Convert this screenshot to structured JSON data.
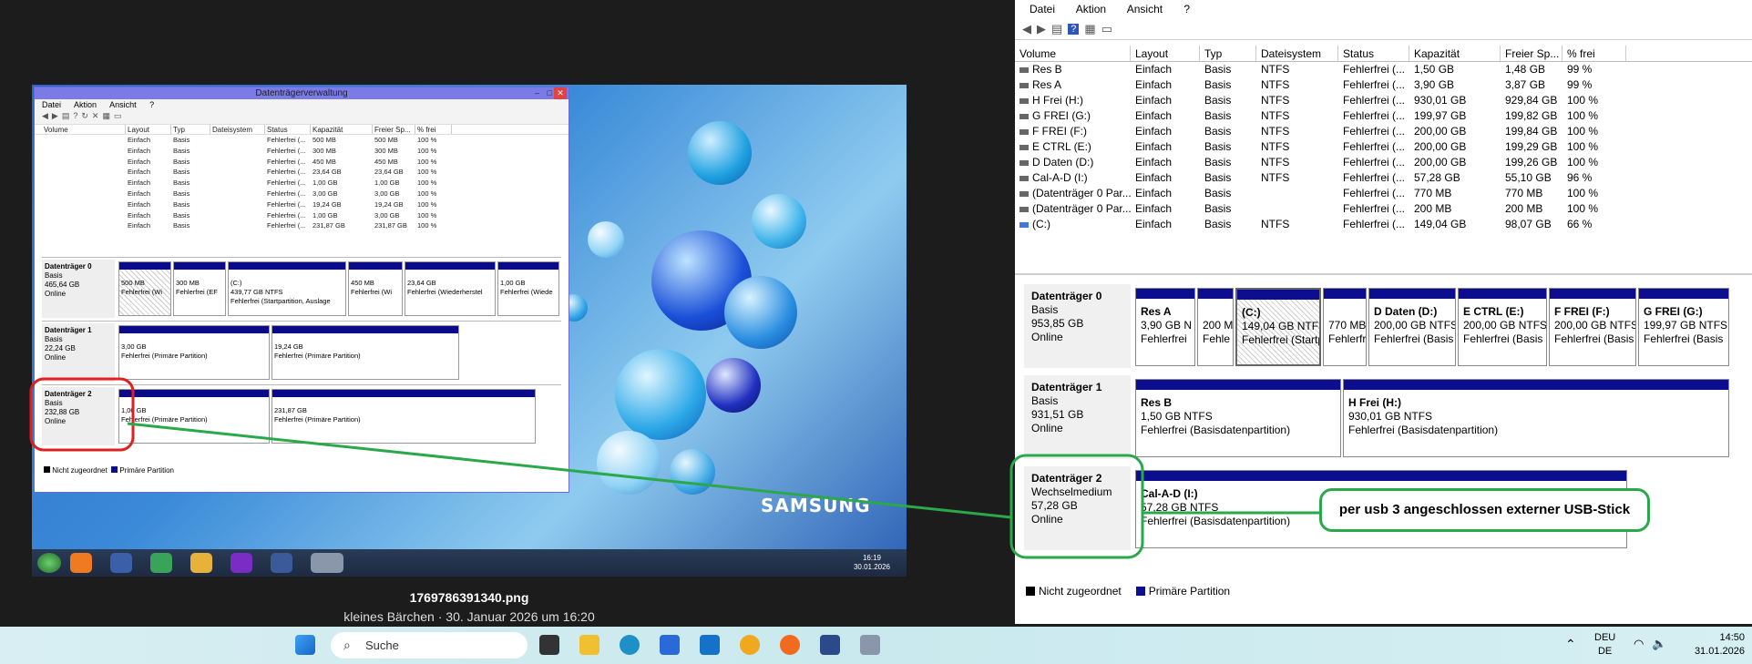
{
  "mini_window": {
    "title": "Datenträgerverwaltung",
    "menu": [
      "Datei",
      "Aktion",
      "Ansicht",
      "?"
    ],
    "columns": [
      "Volume",
      "Layout",
      "Typ",
      "Dateisystem",
      "Status",
      "Kapazität",
      "Freier Sp...",
      "% frei"
    ],
    "rows": [
      [
        "",
        "Einfach",
        "Basis",
        "",
        "Fehlerfrei (...",
        "500 MB",
        "500 MB",
        "100 %"
      ],
      [
        "",
        "Einfach",
        "Basis",
        "",
        "Fehlerfrei (...",
        "300 MB",
        "300 MB",
        "100 %"
      ],
      [
        "",
        "Einfach",
        "Basis",
        "",
        "Fehlerfrei (...",
        "450 MB",
        "450 MB",
        "100 %"
      ],
      [
        "",
        "Einfach",
        "Basis",
        "",
        "Fehlerfrei (...",
        "23,64 GB",
        "23,64 GB",
        "100 %"
      ],
      [
        "",
        "Einfach",
        "Basis",
        "",
        "Fehlerfrei (...",
        "1,00 GB",
        "1,00 GB",
        "100 %"
      ],
      [
        "",
        "Einfach",
        "Basis",
        "",
        "Fehlerfrei (...",
        "3,00 GB",
        "3,00 GB",
        "100 %"
      ],
      [
        "",
        "Einfach",
        "Basis",
        "",
        "Fehlerfrei (...",
        "19,24 GB",
        "19,24 GB",
        "100 %"
      ],
      [
        "",
        "Einfach",
        "Basis",
        "",
        "Fehlerfrei (...",
        "1,00 GB",
        "3,00 GB",
        "100 %"
      ],
      [
        "",
        "Einfach",
        "Basis",
        "",
        "Fehlerfrei (...",
        "231,87 GB",
        "231,87 GB",
        "100 %"
      ]
    ],
    "disks": [
      {
        "name": "Datenträger 0",
        "type": "Basis",
        "size": "465,64 GB",
        "state": "Online",
        "parts": [
          [
            "500 MB",
            "Fehlerfrei (Wi"
          ],
          [
            "300 MB",
            "Fehlerfrei (EF"
          ],
          [
            "(C:)",
            "439,77 GB NTFS",
            "Fehlerfrei (Startpartition, Auslage"
          ],
          [
            "450 MB",
            "Fehlerfrei (Wi"
          ],
          [
            "23,64 GB",
            "Fehlerfrei (Wiederherstel"
          ],
          [
            "1,00 GB",
            "Fehlerfrei (Wiede"
          ]
        ]
      },
      {
        "name": "Datenträger 1",
        "type": "Basis",
        "size": "22,24 GB",
        "state": "Online",
        "parts": [
          [
            "3,00 GB",
            "Fehlerfrei (Primäre Partition)"
          ],
          [
            "19,24 GB",
            "Fehlerfrei (Primäre Partition)"
          ]
        ]
      },
      {
        "name": "Datenträger 2",
        "type": "Basis",
        "size": "232,88 GB",
        "state": "Online",
        "parts": [
          [
            "1,00 GB",
            "Fehlerfrei (Primäre Partition)"
          ],
          [
            "231,87 GB",
            "Fehlerfrei (Primäre Partition)"
          ]
        ]
      }
    ],
    "legend": [
      "Nicht zugeordnet",
      "Primäre Partition"
    ],
    "clock_time": "16:19",
    "clock_date": "30.01.2026",
    "brand": "SAMSUNG"
  },
  "caption": {
    "filename": "1769786391340.png",
    "meta": "kleines Bärchen · 30. Januar 2026 um 16:20"
  },
  "right_window": {
    "menu": [
      "Datei",
      "Aktion",
      "Ansicht",
      "?"
    ],
    "columns": [
      "Volume",
      "Layout",
      "Typ",
      "Dateisystem",
      "Status",
      "Kapazität",
      "Freier Sp...",
      "% frei"
    ],
    "rows": [
      [
        "Res B",
        "Einfach",
        "Basis",
        "NTFS",
        "Fehlerfrei (...",
        "1,50 GB",
        "1,48 GB",
        "99 %"
      ],
      [
        "Res A",
        "Einfach",
        "Basis",
        "NTFS",
        "Fehlerfrei (...",
        "3,90 GB",
        "3,87 GB",
        "99 %"
      ],
      [
        "H Frei (H:)",
        "Einfach",
        "Basis",
        "NTFS",
        "Fehlerfrei (...",
        "930,01 GB",
        "929,84 GB",
        "100 %"
      ],
      [
        "G FREI (G:)",
        "Einfach",
        "Basis",
        "NTFS",
        "Fehlerfrei (...",
        "199,97 GB",
        "199,82 GB",
        "100 %"
      ],
      [
        "F FREI (F:)",
        "Einfach",
        "Basis",
        "NTFS",
        "Fehlerfrei (...",
        "200,00 GB",
        "199,84 GB",
        "100 %"
      ],
      [
        "E CTRL (E:)",
        "Einfach",
        "Basis",
        "NTFS",
        "Fehlerfrei (...",
        "200,00 GB",
        "199,29 GB",
        "100 %"
      ],
      [
        "D Daten (D:)",
        "Einfach",
        "Basis",
        "NTFS",
        "Fehlerfrei (...",
        "200,00 GB",
        "199,26 GB",
        "100 %"
      ],
      [
        "Cal-A-D (I:)",
        "Einfach",
        "Basis",
        "NTFS",
        "Fehlerfrei (...",
        "57,28 GB",
        "55,10 GB",
        "96 %"
      ],
      [
        "(Datenträger 0 Par...",
        "Einfach",
        "Basis",
        "",
        "Fehlerfrei (...",
        "770 MB",
        "770 MB",
        "100 %"
      ],
      [
        "(Datenträger 0 Par...",
        "Einfach",
        "Basis",
        "",
        "Fehlerfrei (...",
        "200 MB",
        "200 MB",
        "100 %"
      ],
      [
        "(C:)",
        "Einfach",
        "Basis",
        "NTFS",
        "Fehlerfrei (...",
        "149,04 GB",
        "98,07 GB",
        "66 %"
      ]
    ],
    "disk0": {
      "name": "Datenträger 0",
      "type": "Basis",
      "size": "953,85 GB",
      "state": "Online",
      "parts": [
        {
          "name": "Res A",
          "size": "3,90 GB N",
          "status": "Fehlerfrei"
        },
        {
          "name": "",
          "size": "200 M",
          "status": "Fehle"
        },
        {
          "name": "(C:)",
          "size": "149,04 GB NTFS",
          "status": "Fehlerfrei (Startp"
        },
        {
          "name": "",
          "size": "770 MB",
          "status": "Fehlerfr"
        },
        {
          "name": "D Daten  (D:)",
          "size": "200,00 GB NTFS",
          "status": "Fehlerfrei (Basis"
        },
        {
          "name": "E CTRL  (E:)",
          "size": "200,00 GB NTFS",
          "status": "Fehlerfrei (Basis"
        },
        {
          "name": "F FREI  (F:)",
          "size": "200,00 GB NTFS",
          "status": "Fehlerfrei (Basis"
        },
        {
          "name": "G FREI  (G:)",
          "size": "199,97 GB NTFS",
          "status": "Fehlerfrei (Basis"
        }
      ]
    },
    "disk1": {
      "name": "Datenträger 1",
      "type": "Basis",
      "size": "931,51 GB",
      "state": "Online",
      "parts": [
        {
          "name": "Res B",
          "size": "1,50 GB NTFS",
          "status": "Fehlerfrei (Basisdatenpartition)"
        },
        {
          "name": "H Frei  (H:)",
          "size": "930,01 GB NTFS",
          "status": "Fehlerfrei (Basisdatenpartition)"
        }
      ]
    },
    "disk2": {
      "name": "Datenträger 2",
      "type": "Wechselmedium",
      "size": "57,28 GB",
      "state": "Online",
      "parts": [
        {
          "name": "Cal-A-D  (I:)",
          "size": "57,28 GB NTFS",
          "status": "Fehlerfrei (Basisdatenpartition)"
        }
      ]
    },
    "legend": [
      "Nicht zugeordnet",
      "Primäre Partition"
    ]
  },
  "annotation": "per usb 3 angeschlossen externer USB-Stick",
  "taskbar": {
    "search_placeholder": "Suche",
    "lang_top": "DEU",
    "lang_bottom": "DE",
    "time": "14:50",
    "date": "31.01.2026"
  },
  "colors": {
    "partition_bar": "#0d0d8f",
    "annotation_green": "#2aa84a",
    "annotation_red": "#e02020"
  }
}
